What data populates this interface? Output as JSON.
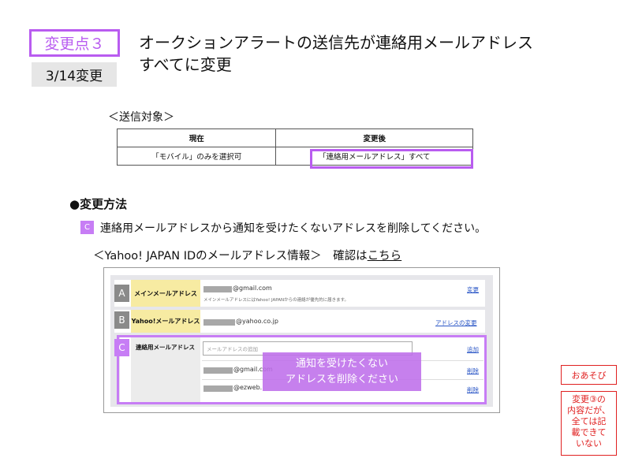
{
  "header": {
    "badge": "変更点３",
    "date": "3/14変更",
    "title_line1": "オークションアラートの送信先が連絡用メールアドレス",
    "title_line2": "すべてに変更"
  },
  "target": {
    "heading": "＜送信対象＞",
    "col_current": "現在",
    "col_after": "変更後",
    "val_current": "「モバイル」のみを選択可",
    "val_after": "「連絡用メールアドレス」すべて"
  },
  "method": {
    "heading": "●変更方法",
    "step_badge": "C",
    "instruction": "連絡用メールアドレスから通知を受けたくないアドレスを削除してください。",
    "yahoo_prefix": "＜Yahoo! JAPAN IDのメールアドレス情報＞　確認は",
    "yahoo_link": "こちら"
  },
  "panel": {
    "rowA": {
      "letter": "A",
      "label": "メインメールアドレス",
      "email_suffix": "@gmail.com",
      "note": "メインメールアドレスにはYahoo! JAPANからの連絡が優先的に届きます。",
      "action": "変更"
    },
    "rowB": {
      "letter": "B",
      "label": "Yahoo!メールアドレス",
      "email_suffix": "@yahoo.co.jp",
      "action": "アドレスの変更"
    },
    "rowC": {
      "letter": "C",
      "label": "連絡用メールアドレス",
      "input_placeholder": "メールアドレスの追加",
      "add_action": "追加",
      "email1_suffix": "@gmail.com",
      "email2_suffix": "@ezweb.",
      "delete_action": "削除"
    },
    "overlay_line1": "通知を受けたくない",
    "overlay_line2": "アドレスを削除ください"
  },
  "notes": {
    "note1": "おあそび",
    "note2_l1": "変更③の",
    "note2_l2": "内容だが、",
    "note2_l3": "全ては記",
    "note2_l4": "載できて",
    "note2_l5": "いない"
  },
  "colors": {
    "accent_purple": "#b95cf0",
    "label_yellow": "#f7eba2",
    "note_red": "#e02020",
    "link_blue": "#2a56c6"
  }
}
